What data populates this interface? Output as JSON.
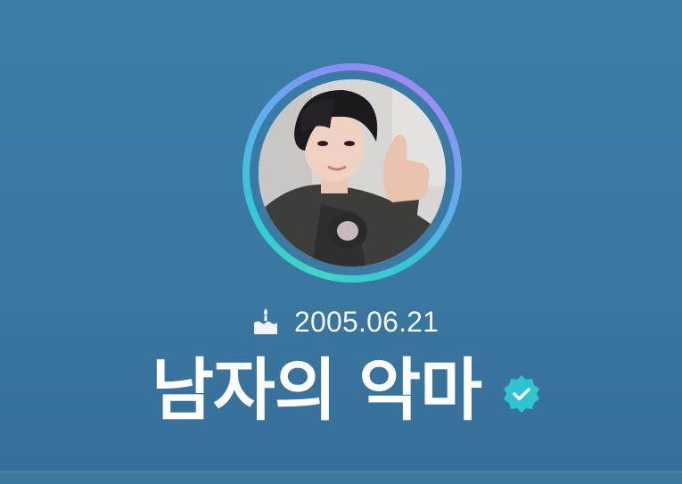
{
  "profile": {
    "birthday": "2005.06.21",
    "display_name": "남자의 악마",
    "verified": true,
    "avatar": {
      "description_icon": "profile-photo"
    }
  },
  "icons": {
    "birthday": "cake-icon",
    "verified": "verified-badge-icon"
  },
  "colors": {
    "background": "#3a7aa4",
    "ring_start": "#3fd6c4",
    "ring_end": "#a08cf2",
    "verified": "#2ec4d0",
    "text": "#ffffff"
  }
}
